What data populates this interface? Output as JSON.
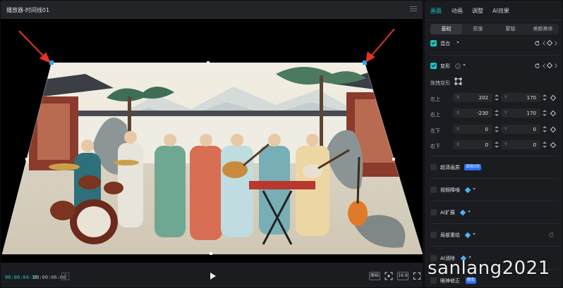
{
  "player": {
    "title": "播放器-时间线01",
    "time_current": "00:00:04:15",
    "time_total": "00:00:06:00",
    "original_label": "原始",
    "ratio_label": "16:9",
    "colors": {
      "accent": "#19c6c4",
      "handle": "#2ea8ff",
      "arrow": "#e0342b"
    }
  },
  "panel": {
    "tabs": [
      {
        "label": "画面",
        "active": true
      },
      {
        "label": "动画",
        "active": false
      },
      {
        "label": "调整",
        "active": false
      },
      {
        "label": "AI效果",
        "active": false
      }
    ],
    "subtabs": [
      {
        "label": "基础",
        "active": true
      },
      {
        "label": "抠像",
        "active": false
      },
      {
        "label": "蒙版",
        "active": false
      },
      {
        "label": "美颜美体",
        "active": false
      }
    ],
    "blend": {
      "label": "混合",
      "checked": true
    },
    "transform": {
      "label": "变形",
      "checked": true,
      "drag_label": "拖拽变形",
      "corners": [
        {
          "label": "左上",
          "x": "202",
          "y": "170"
        },
        {
          "label": "右上",
          "x": "-230",
          "y": "170"
        },
        {
          "label": "左下",
          "x": "0",
          "y": "0"
        },
        {
          "label": "右下",
          "x": "0",
          "y": "0"
        }
      ],
      "x_axis": "X",
      "y_axis": "Y"
    },
    "features": [
      {
        "label": "超清画质",
        "badge": "试用3次",
        "checked": false
      },
      {
        "label": "视频降噪",
        "checked": false,
        "icon": "vip-gem-icon"
      },
      {
        "label": "AI扩展",
        "checked": false,
        "icon": "vip-gem-icon"
      },
      {
        "label": "局部重绘",
        "checked": false,
        "icon": "vip-gem-icon"
      },
      {
        "label": "AI消除",
        "checked": false,
        "icon": "vip-gem-icon"
      },
      {
        "label": "眼神修正",
        "badge": "限免",
        "checked": false
      }
    ]
  },
  "watermark": "sanlang2021"
}
